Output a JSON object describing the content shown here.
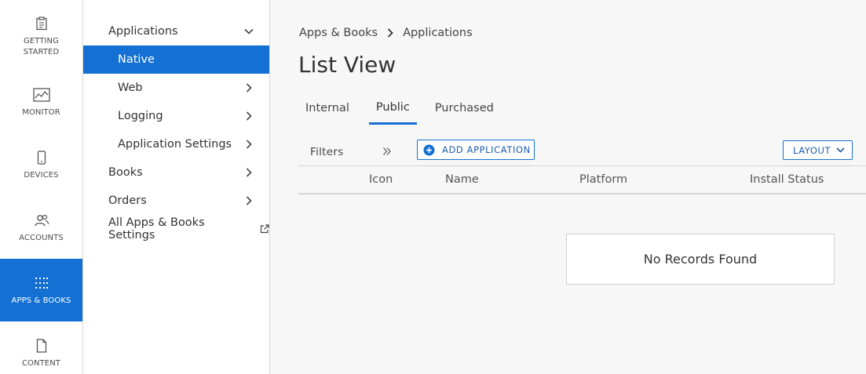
{
  "rail": {
    "items": [
      {
        "label": "GETTING STARTED",
        "icon": "clipboard-icon"
      },
      {
        "label": "MONITOR",
        "icon": "chart-icon"
      },
      {
        "label": "DEVICES",
        "icon": "phone-icon"
      },
      {
        "label": "ACCOUNTS",
        "icon": "users-icon"
      },
      {
        "label": "APPS & BOOKS",
        "icon": "apps-grid-icon",
        "active": true
      },
      {
        "label": "CONTENT",
        "icon": "document-icon"
      }
    ]
  },
  "subnav": {
    "items": [
      {
        "label": "Applications",
        "level": 1,
        "expanded": true
      },
      {
        "label": "Native",
        "level": 2,
        "active": true
      },
      {
        "label": "Web",
        "level": 2
      },
      {
        "label": "Logging",
        "level": 2
      },
      {
        "label": "Application Settings",
        "level": 2
      },
      {
        "label": "Books",
        "level": 1
      },
      {
        "label": "Orders",
        "level": 1
      },
      {
        "label": "All Apps & Books Settings",
        "level": 1,
        "external": true
      }
    ]
  },
  "breadcrumb": {
    "root": "Apps & Books",
    "current": "Applications"
  },
  "page": {
    "title": "List View"
  },
  "tabs": [
    {
      "label": "Internal"
    },
    {
      "label": "Public",
      "active": true
    },
    {
      "label": "Purchased"
    }
  ],
  "toolbar": {
    "filters_label": "Filters",
    "add_label": "ADD APPLICATION",
    "layout_label": "LAYOUT"
  },
  "grid": {
    "columns": [
      "Icon",
      "Name",
      "Platform",
      "Install Status"
    ],
    "empty_message": "No Records Found"
  },
  "colors": {
    "accent": "#1471d3",
    "background": "#f7f7f7"
  }
}
